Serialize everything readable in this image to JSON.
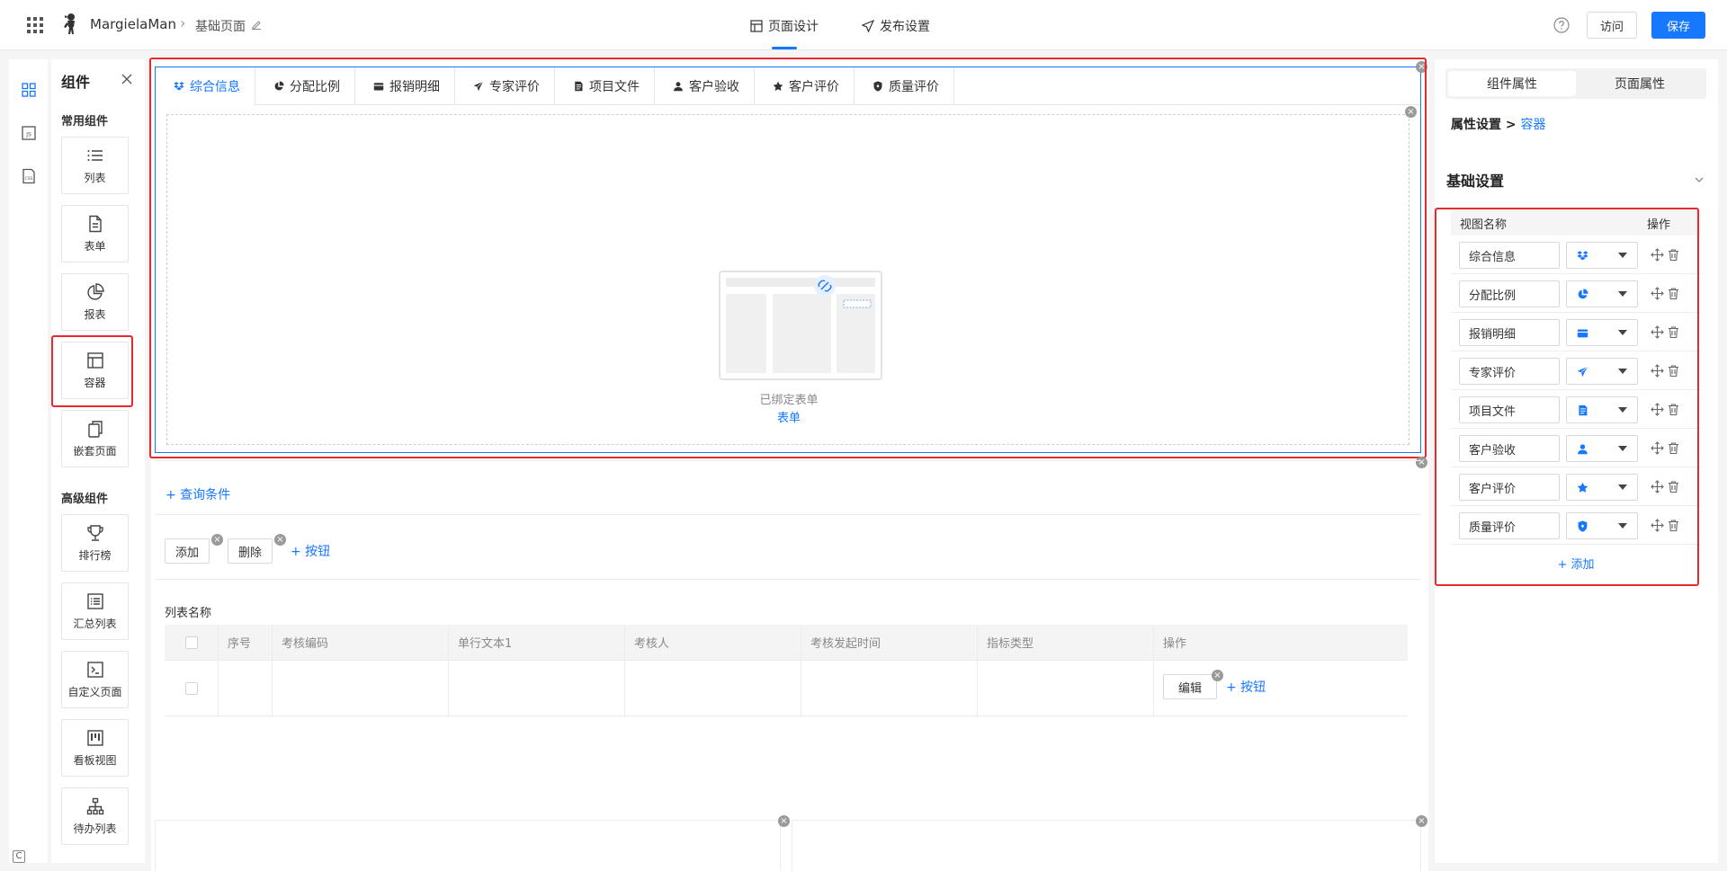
{
  "header": {
    "app_name": "MargielaMan",
    "page_name": "基础页面",
    "modes": [
      {
        "label": "页面设计",
        "icon": "layout-icon"
      },
      {
        "label": "发布设置",
        "icon": "send-icon"
      }
    ],
    "visit_label": "访问",
    "save_label": "保存"
  },
  "components_panel": {
    "title": "组件",
    "common_title": "常用组件",
    "common": [
      {
        "label": "列表",
        "icon": "list-icon"
      },
      {
        "label": "表单",
        "icon": "form-icon"
      },
      {
        "label": "报表",
        "icon": "pie-chart-icon"
      },
      {
        "label": "容器",
        "icon": "container-icon"
      },
      {
        "label": "嵌套页面",
        "icon": "copy-icon"
      }
    ],
    "advanced_title": "高级组件",
    "advanced": [
      {
        "label": "排行榜",
        "icon": "trophy-icon"
      },
      {
        "label": "汇总列表",
        "icon": "summary-list-icon"
      },
      {
        "label": "自定义页面",
        "icon": "terminal-icon"
      },
      {
        "label": "看板视图",
        "icon": "kanban-icon"
      },
      {
        "label": "待办列表",
        "icon": "org-tree-icon"
      }
    ]
  },
  "container": {
    "tabs": [
      {
        "label": "综合信息",
        "icon": "dropbox-icon"
      },
      {
        "label": "分配比例",
        "icon": "pie-icon"
      },
      {
        "label": "报销明细",
        "icon": "card-icon"
      },
      {
        "label": "专家评价",
        "icon": "send-icon"
      },
      {
        "label": "项目文件",
        "icon": "file-icon"
      },
      {
        "label": "客户验收",
        "icon": "user-icon"
      },
      {
        "label": "客户评价",
        "icon": "star-icon"
      },
      {
        "label": "质量评价",
        "icon": "shield-icon"
      }
    ],
    "active_tab": 0,
    "bound_text": "已绑定表单",
    "bound_link": "表单"
  },
  "list_block": {
    "query_link": "+ 查询条件",
    "buttons": [
      "添加",
      "删除"
    ],
    "add_button_link": "+ 按钮",
    "list_name": "列表名称",
    "columns": [
      "",
      "序号",
      "考核编码",
      "单行文本1",
      "考核人",
      "考核发起时间",
      "指标类型",
      "操作"
    ],
    "row_edit": "编辑",
    "row_add_button": "+ 按钮"
  },
  "properties": {
    "tabs": [
      "组件属性",
      "页面属性"
    ],
    "active_tab": 0,
    "crumb_root": "属性设置",
    "crumb_sep": ">",
    "crumb_current": "容器",
    "section_title": "基础设置",
    "view_header_name": "视图名称",
    "view_header_ops": "操作",
    "views": [
      {
        "name": "综合信息",
        "icon": "dropbox-icon"
      },
      {
        "name": "分配比例",
        "icon": "pie-icon"
      },
      {
        "name": "报销明细",
        "icon": "card-icon"
      },
      {
        "name": "专家评价",
        "icon": "send-icon"
      },
      {
        "name": "项目文件",
        "icon": "file-icon"
      },
      {
        "name": "客户验收",
        "icon": "user-icon"
      },
      {
        "name": "客户评价",
        "icon": "star-icon"
      },
      {
        "name": "质量评价",
        "icon": "shield-icon"
      }
    ],
    "add_link": "+ 添加"
  },
  "colors": {
    "accent": "#1677ff",
    "highlight": "#e8282c"
  }
}
